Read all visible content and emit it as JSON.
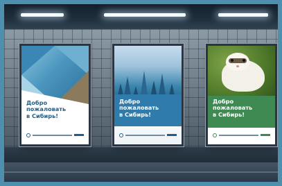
{
  "scene": {
    "description_tag": "subway-station-billboards",
    "accent_frame_color": "#4e8fae"
  },
  "posters": [
    {
      "headline_lines": [
        "Добро",
        "пожаловать",
        "в Сибирь!"
      ],
      "theme_color": "#1f5e8c",
      "motif": "geometric-photo-collage"
    },
    {
      "headline_lines": [
        "Добро",
        "пожаловать",
        "в Сибирь!"
      ],
      "theme_color": "#2f7bab",
      "motif": "forest"
    },
    {
      "headline_lines": [
        "Добро",
        "пожаловать",
        "в Сибирь!"
      ],
      "theme_color": "#3f8a52",
      "motif": "ferret"
    }
  ]
}
